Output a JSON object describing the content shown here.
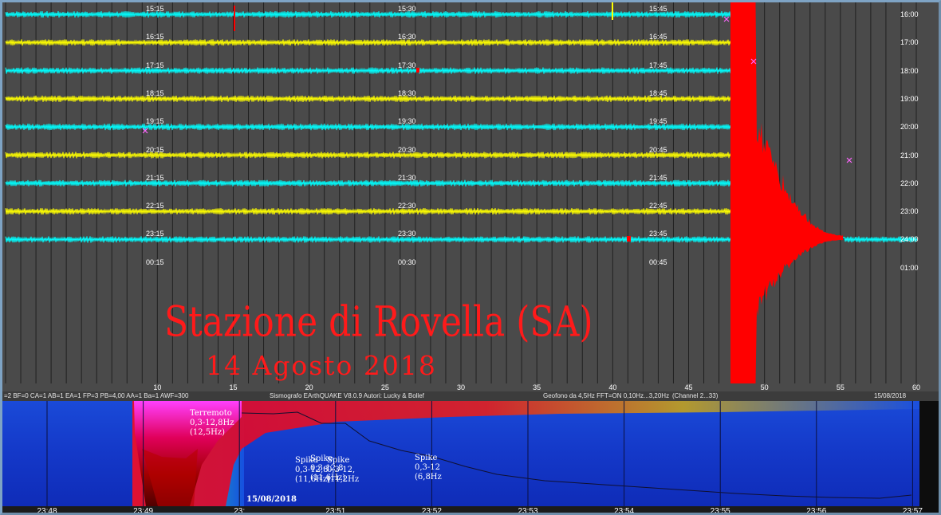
{
  "helicorder": {
    "colors": {
      "background": "#4a4a4a",
      "trace_cyan": "#00ffff",
      "trace_yellow": "#ffff00",
      "event": "#ff0000",
      "marker": "#ff66ff",
      "grid": "#202020"
    },
    "rows": [
      {
        "hour": "16:00",
        "t1": "15:15",
        "t2": "15:30",
        "t3": "15:45",
        "color": "cyan"
      },
      {
        "hour": "17:00",
        "t1": "16:15",
        "t2": "16:30",
        "t3": "16:45",
        "color": "yellow"
      },
      {
        "hour": "18:00",
        "t1": "17:15",
        "t2": "17:30",
        "t3": "17:45",
        "color": "cyan"
      },
      {
        "hour": "19:00",
        "t1": "18:15",
        "t2": "18:30",
        "t3": "18:45",
        "color": "yellow"
      },
      {
        "hour": "20:00",
        "t1": "19:15",
        "t2": "19:30",
        "t3": "19:45",
        "color": "cyan"
      },
      {
        "hour": "21:00",
        "t1": "20:15",
        "t2": "20:30",
        "t3": "20:45",
        "color": "yellow"
      },
      {
        "hour": "22:00",
        "t1": "21:15",
        "t2": "21:30",
        "t3": "21:45",
        "color": "cyan"
      },
      {
        "hour": "23:00",
        "t1": "22:15",
        "t2": "22:30",
        "t3": "22:45",
        "color": "yellow"
      },
      {
        "hour": "24:00",
        "t1": "23:15",
        "t2": "23:30",
        "t3": "23:45",
        "color": "cyan"
      },
      {
        "hour": "01:00",
        "t1": "00:15",
        "t2": "00:30",
        "t3": "00:45",
        "color": "none"
      }
    ],
    "x_ticks": [
      "10",
      "15",
      "20",
      "25",
      "30",
      "35",
      "40",
      "45",
      "50",
      "55",
      "60"
    ]
  },
  "overlay": {
    "title": "Stazione di Rovella (SA)",
    "date": "14 Agosto 2018"
  },
  "status_bar": {
    "params": "=2 BF=0 CA=1 AB=1 EA=1 FP=3 PB=4,00 AA=1 Ba=1 AWF=300",
    "software": "Sismografo EArthQUAKE  V8.0.9  Autori: Lucky & Bollef",
    "sensor": "Geofono da 4,5Hz FFT=ON 0,10Hz...3,20Hz",
    "channel": "(Channel 2...33)",
    "date": "15/08/2018"
  },
  "spectrogram": {
    "colors": {
      "background": "#1130c8",
      "hot": "#ff0080",
      "event": "#d40000"
    },
    "annotations": {
      "quake": {
        "l1": "Terremoto",
        "l2": "0,3-12,8Hz",
        "l3": "(12,5Hz)"
      },
      "spike_a": {
        "l1": "Spike",
        "l2": "0,3-12,8",
        "l3": "(11,6Hz)"
      },
      "spike_b": {
        "l1": "Spike",
        "l2": "0,3-12,8",
        "l3": "(11,6Hz)"
      },
      "spike_c": {
        "l1": "Spike",
        "l2": "0,3-12,",
        "l3": "(11,2Hz"
      },
      "spike_d": {
        "l1": "Spike",
        "l2": "0,3-12",
        "l3": "(6,8Hz"
      }
    },
    "date": "15/08/2018",
    "time_ticks": [
      "23:48",
      "23:49",
      "23:",
      "23:51",
      "23:52",
      "23:53",
      "23:54",
      "23:55",
      "23:56",
      "23:57"
    ]
  }
}
